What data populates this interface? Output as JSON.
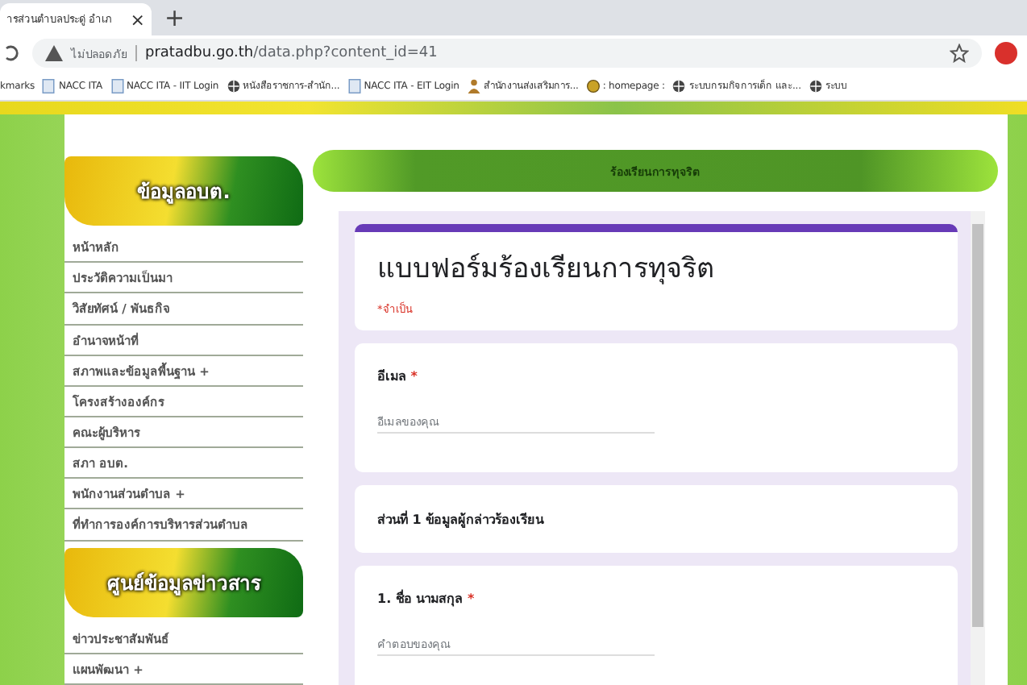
{
  "browser": {
    "tab": {
      "title": "ารส่วนตำบลประดู่ อำเภ",
      "close": "×"
    },
    "new_tab": "+",
    "security": "ไม่ปลอดภัย",
    "url_host": "pratadbu.go.th",
    "url_path": "/data.php?content_id=41",
    "bookmarks": [
      {
        "kind": "none",
        "label": "kmarks"
      },
      {
        "kind": "page",
        "label": "NACC ITA"
      },
      {
        "kind": "page",
        "label": "NACC ITA - IIT Login"
      },
      {
        "kind": "globe",
        "label": "หนังสือราชการ-สำนัก..."
      },
      {
        "kind": "page",
        "label": "NACC ITA - EIT Login"
      },
      {
        "kind": "person",
        "label": "สำนักงานส่งเสริมการ..."
      },
      {
        "kind": "face",
        "label": ": homepage :"
      },
      {
        "kind": "globe",
        "label": "ระบบกรมกิจการเด็ก และ..."
      },
      {
        "kind": "globe",
        "label": "ระบบ"
      }
    ]
  },
  "sidebar": {
    "sections": [
      {
        "heading": "ข้อมูลอบต.",
        "items": [
          "หน้าหลัก",
          "ประวัติความเป็นมา",
          "วิสัยทัศน์ / พันธกิจ",
          "อำนาจหน้าที่",
          "สภาพและข้อมูลพื้นฐาน +",
          "โครงสร้างองค์กร",
          "คณะผู้บริหาร",
          "สภา อบต.",
          "พนักงานส่วนตำบล +",
          "ที่ทำการองค์การบริหารส่วนตำบล"
        ]
      },
      {
        "heading": "ศูนย์ข้อมูลข่าวสาร",
        "items": [
          "ข่าวประชาสัมพันธ์",
          "แผนพัฒนา +"
        ]
      }
    ]
  },
  "banner": "ร้องเรียนการทุจริต",
  "form": {
    "title": "แบบฟอร์มร้องเรียนการทุจริต",
    "required_note": "*จำเป็น",
    "cards": [
      {
        "kind": "question",
        "label": "อีเมล",
        "required_mark": "*",
        "placeholder": "อีเมลของคุณ"
      },
      {
        "kind": "section",
        "label": "ส่วนที่ 1 ข้อมูลผู้กล่าวร้องเรียน"
      },
      {
        "kind": "question",
        "label": "1. ชื่อ นามสกุล",
        "required_mark": "*",
        "placeholder": "คำตอบของคุณ"
      }
    ]
  }
}
